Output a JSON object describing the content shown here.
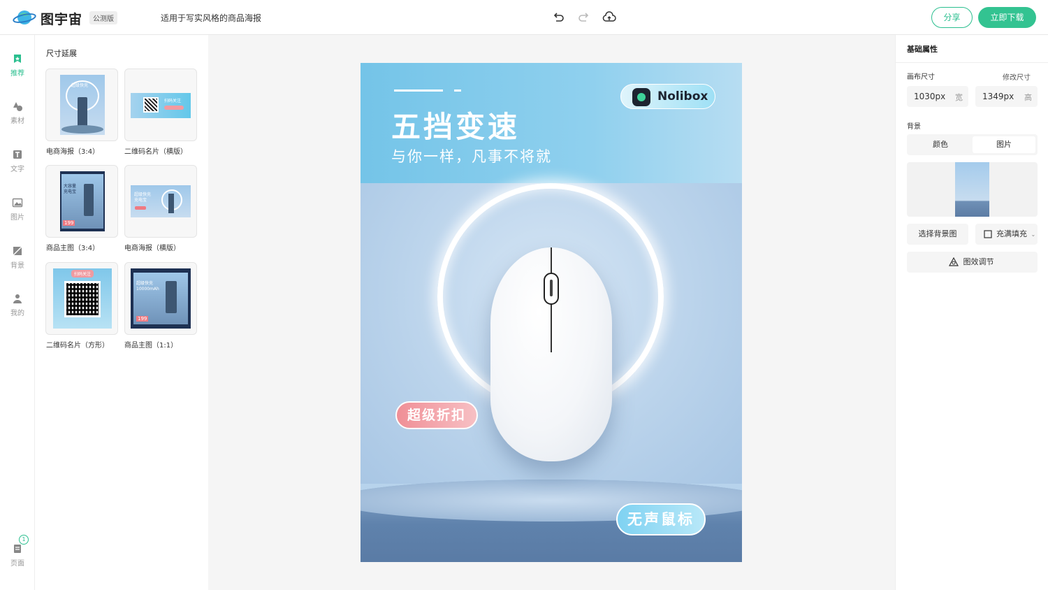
{
  "header": {
    "app_name": "图宇宙",
    "badge": "公测版",
    "doc_title": "适用于写实风格的商品海报",
    "undo_icon": "undo-icon",
    "redo_icon": "redo-icon",
    "cloud_icon": "cloud-upload-icon",
    "share_label": "分享",
    "download_label": "立即下载",
    "accent": "#33c391"
  },
  "sidenav": {
    "items": [
      {
        "label": "推荐",
        "icon": "recommend-icon",
        "active": true
      },
      {
        "label": "素材",
        "icon": "shapes-icon"
      },
      {
        "label": "文字",
        "icon": "text-icon"
      },
      {
        "label": "图片",
        "icon": "image-icon"
      },
      {
        "label": "背景",
        "icon": "background-icon"
      },
      {
        "label": "我的",
        "icon": "user-icon"
      }
    ],
    "pages": {
      "label": "页面",
      "count": "1",
      "icon": "pages-icon"
    }
  },
  "panel": {
    "title": "尺寸延展",
    "templates": [
      {
        "label": "电商海报（3:4）",
        "text": "超级快充"
      },
      {
        "label": "二维码名片（横版）",
        "text": "扫码关注"
      },
      {
        "label": "商品主图（3:4）",
        "text": "大容量 充电宝",
        "price": "199"
      },
      {
        "label": "电商海报（横版）",
        "text": "超级快充 充电宝"
      },
      {
        "label": "二维码名片（方形）",
        "text": "扫码关注"
      },
      {
        "label": "商品主图（1:1）",
        "text": "超级快充 10000mAh",
        "price": "199"
      }
    ]
  },
  "poster": {
    "headline": "五挡变速",
    "subline": "与你一样，凡事不将就",
    "brand": "Nolibox",
    "tag_discount": "超级折扣",
    "tag_product": "无声鼠标"
  },
  "rpanel": {
    "title": "基础属性",
    "canvas_size_label": "画布尺寸",
    "modify_size_label": "修改尺寸",
    "width_value": "1030px",
    "width_unit": "宽",
    "height_value": "1349px",
    "height_unit": "高",
    "background_label": "背景",
    "tab_color": "颜色",
    "tab_image": "图片",
    "choose_bg_label": "选择背景图",
    "fill_label": "充满填充",
    "effect_label": "图效调节"
  }
}
